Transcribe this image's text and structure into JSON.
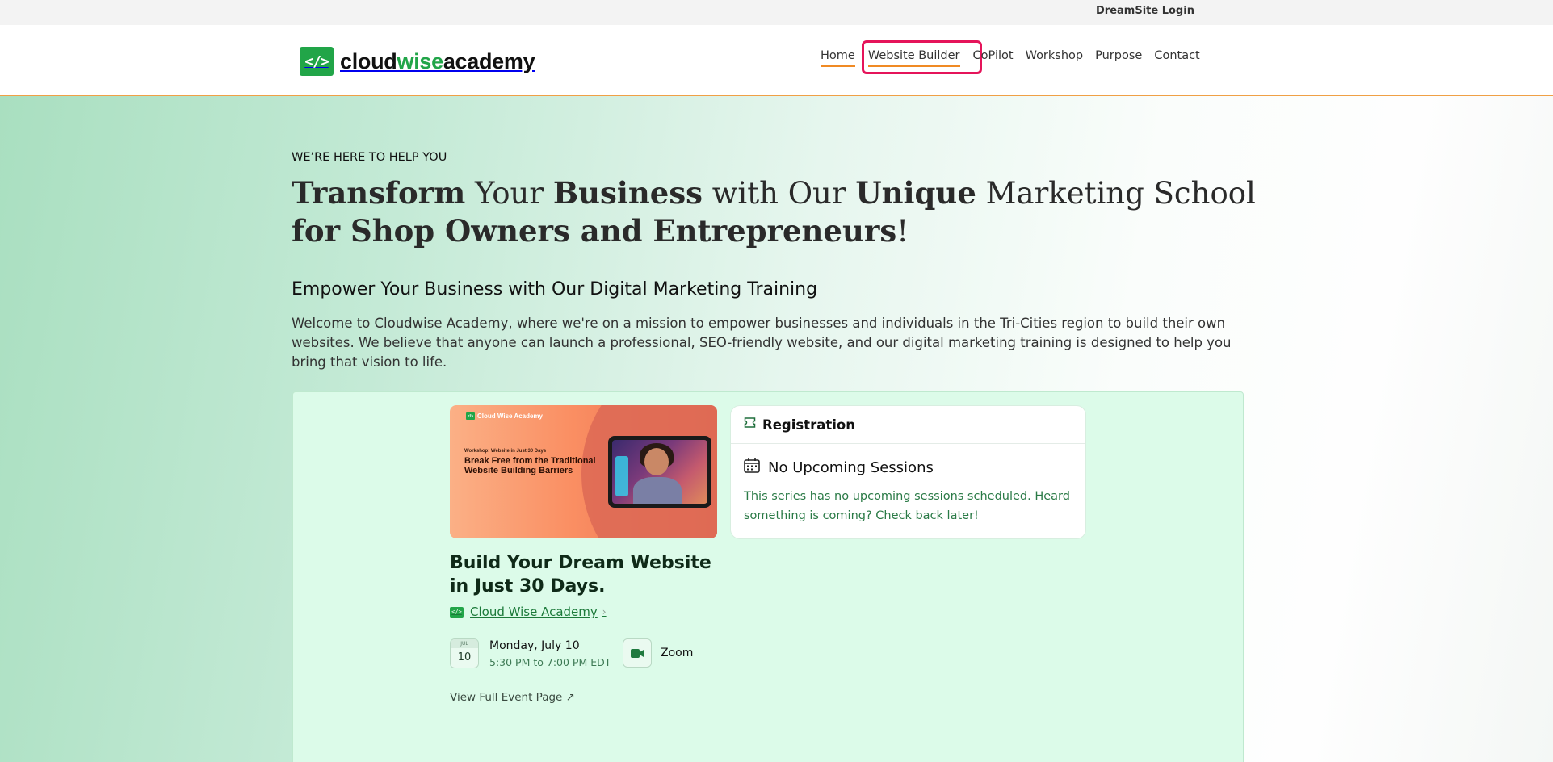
{
  "topbar": {
    "login_label": "DreamSite Login"
  },
  "logo": {
    "mark": "</>",
    "part1": "cloud",
    "part2": "wise",
    "part3": "academy"
  },
  "nav": {
    "items": [
      {
        "label": "Home"
      },
      {
        "label": "Website Builder"
      },
      {
        "label": "CoPilot"
      },
      {
        "label": "Workshop"
      },
      {
        "label": "Purpose"
      },
      {
        "label": "Contact"
      }
    ],
    "accent_color": "#f08a24",
    "highlight_color": "#e5145a"
  },
  "hero": {
    "eyebrow": "WE’RE HERE TO HELP YOU",
    "headline": {
      "w1": "Transform",
      "w2": " Your ",
      "w3": "Business",
      "w4": " with Our ",
      "w5": "Unique",
      "w6": " Marketing School ",
      "w7": "for Shop Owners and Entrepreneurs",
      "w8": "!"
    },
    "subhead": "Empower Your Business with Our Digital Marketing Training",
    "intro": "Welcome to Cloudwise Academy, where we're on a mission to empower businesses and individuals in the Tri-Cities region to build their own websites. We believe that anyone can launch a professional, SEO-friendly website, and our digital marketing training is designed to help you bring that vision to life."
  },
  "event": {
    "cover": {
      "brand": "Cloud Wise Academy",
      "kicker": "Workshop: Website in Just 30 Days",
      "title": "Break Free from the Traditional Website Building Barriers"
    },
    "title": "Build Your Dream Website in Just 30 Days.",
    "organizer": "Cloud Wise Academy",
    "date_month": "JUL",
    "date_day": "10",
    "date_main": "Monday, July 10",
    "date_time": "5:30 PM to 7:00 PM EDT",
    "location": "Zoom",
    "full_link": "View Full Event Page ↗"
  },
  "registration": {
    "title": "Registration",
    "status_title": "No Upcoming Sessions",
    "message": "This series has no upcoming sessions scheduled. Heard something is coming? Check back later!"
  },
  "icons": {
    "ticket": "ticket-icon",
    "calendar": "calendar-icon",
    "video": "video-camera-icon",
    "chevron": "chevron-right-icon"
  },
  "colors": {
    "brand_green": "#21a548",
    "link_green": "#1c7a3a",
    "widget_bg": "#dcfbe9"
  }
}
